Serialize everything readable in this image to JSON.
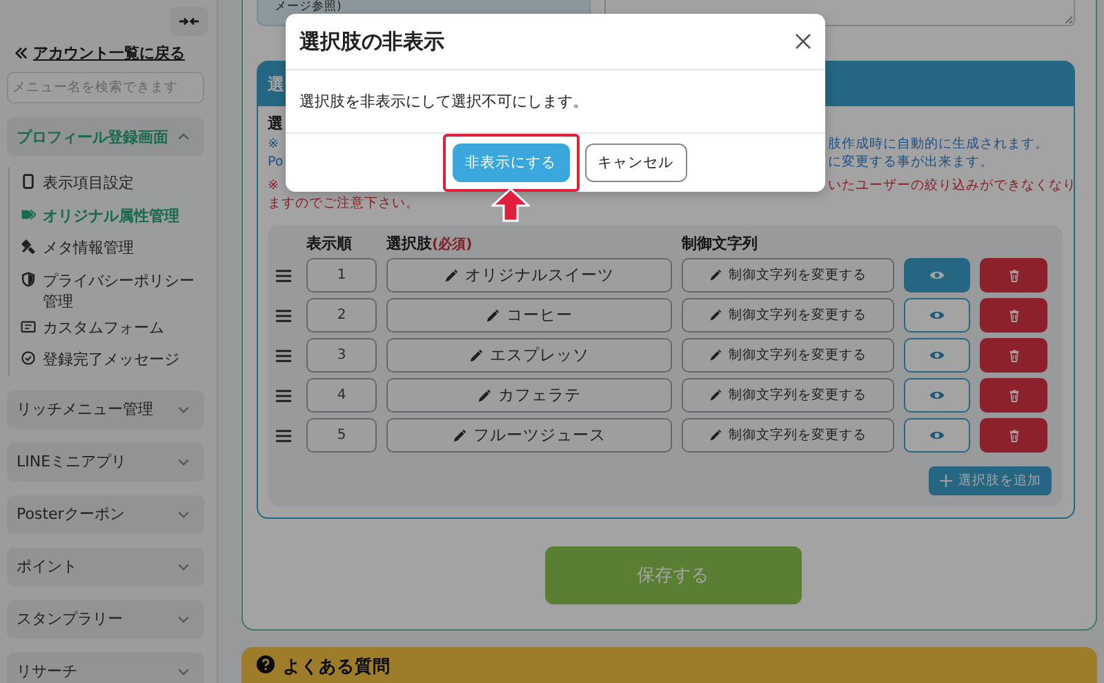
{
  "sidebar": {
    "back_link": "アカウント一覧に戻る",
    "search": {
      "placeholder": "メニュー名を検索できます"
    },
    "groups": [
      {
        "label": "プロフィール登録画面",
        "expanded": true,
        "children": [
          {
            "label": "表示項目設定",
            "selected": false
          },
          {
            "label": "オリジナル属性管理",
            "selected": true
          },
          {
            "label": "メタ情報管理",
            "selected": false
          },
          {
            "label": "プライバシーポリシー管理",
            "selected": false
          },
          {
            "label": "カスタムフォーム",
            "selected": false
          },
          {
            "label": "登録完了メッセージ",
            "selected": false
          }
        ]
      },
      {
        "label": "リッチメニュー管理",
        "expanded": false
      },
      {
        "label": "LINEミニアプリ",
        "expanded": false
      },
      {
        "label": "Posterクーポン",
        "expanded": false
      },
      {
        "label": "ポイント",
        "expanded": false
      },
      {
        "label": "スタンプラリー",
        "expanded": false
      },
      {
        "label": "リサーチ",
        "expanded": false
      }
    ]
  },
  "main": {
    "image_note": "メージ参照)",
    "choices_card": {
      "title": "選",
      "section_label": "選",
      "notes": [
        {
          "kind": "info",
          "left": "※",
          "right": "肢作成時に自動的に生成されます。"
        },
        {
          "kind": "info",
          "left": "Po",
          "right": "に変更する事が出来ます。"
        },
        {
          "kind": "warning",
          "left": "※",
          "right": "いたユーザーの絞り込みができなくなり"
        },
        {
          "kind": "warning",
          "left": "ますのでご注意下さい。"
        }
      ],
      "table": {
        "columns": [
          {
            "label": "表示順"
          },
          {
            "label": "選択肢",
            "required": "(必須)"
          },
          {
            "label": "制御文字列"
          }
        ],
        "rows": [
          {
            "order": "1",
            "choice": "オリジナルスイーツ",
            "control": "制御文字列を変更する",
            "eye_active": true
          },
          {
            "order": "2",
            "choice": "コーヒー",
            "control": "制御文字列を変更する",
            "eye_active": false
          },
          {
            "order": "3",
            "choice": "エスプレッソ",
            "control": "制御文字列を変更する",
            "eye_active": false
          },
          {
            "order": "4",
            "choice": "カフェラテ",
            "control": "制御文字列を変更する",
            "eye_active": false
          },
          {
            "order": "5",
            "choice": "フルーツジュース",
            "control": "制御文字列を変更する",
            "eye_active": false
          }
        ],
        "add_button": "選択肢を追加"
      }
    },
    "save_button": "保存する",
    "faq": "よくある質問"
  },
  "modal": {
    "title": "選択肢の非表示",
    "body": "選択肢を非表示にして選択不可にします。",
    "confirm": "非表示にする",
    "cancel": "キャンセル"
  }
}
